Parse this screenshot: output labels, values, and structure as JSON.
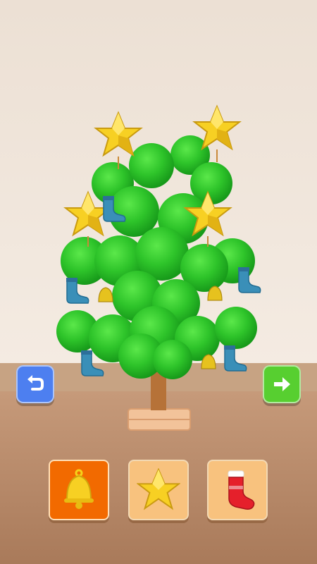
{
  "scene": {
    "wall_color": "#f1e7dd",
    "floor_color": "#b98b6c",
    "tree_color": "#2ec42a",
    "ornaments": [
      {
        "type": "star-icon"
      },
      {
        "type": "star-icon"
      },
      {
        "type": "star-icon"
      },
      {
        "type": "star-icon"
      },
      {
        "type": "stocking-icon",
        "color": "blue"
      },
      {
        "type": "bell-icon",
        "color": "yellow"
      }
    ]
  },
  "controls": {
    "undo": {
      "icon": "undo-icon",
      "color": "#4d7ff0"
    },
    "next": {
      "icon": "arrow-right-icon",
      "color": "#57cf30"
    }
  },
  "toolbar": {
    "tools": [
      {
        "id": "bell",
        "icon": "bell-icon",
        "selected": true
      },
      {
        "id": "star",
        "icon": "star-icon",
        "selected": false
      },
      {
        "id": "stocking",
        "icon": "stocking-icon",
        "selected": false
      }
    ]
  }
}
